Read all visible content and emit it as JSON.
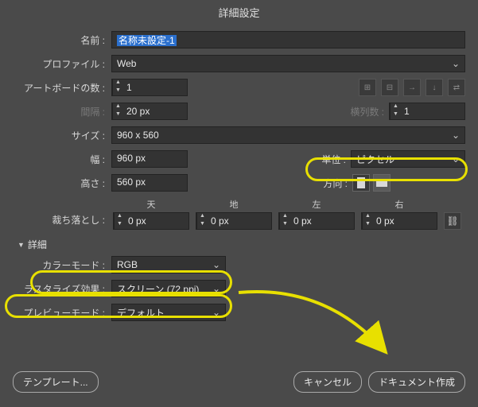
{
  "title": "詳細設定",
  "labels": {
    "name": "名前 :",
    "profile": "プロファイル :",
    "artboards": "アートボードの数 :",
    "spacing": "間隔 :",
    "columns": "横列数 :",
    "size": "サイズ :",
    "width": "幅 :",
    "height": "高さ :",
    "units": "単位 :",
    "orient": "方向 :",
    "bleed": "裁ち落とし :",
    "top": "天",
    "bottom": "地",
    "left": "左",
    "right": "右",
    "advanced": "詳細",
    "colormode": "カラーモード :",
    "raster": "ラスタライズ効果 :",
    "preview": "プレビューモード :"
  },
  "values": {
    "name": "名称未設定-1",
    "profile": "Web",
    "artboards": "1",
    "spacing": "20 px",
    "columns": "1",
    "size": "960 x 560",
    "width": "960 px",
    "height": "560 px",
    "units": "ピクセル",
    "bleed_top": "0 px",
    "bleed_bottom": "0 px",
    "bleed_left": "0 px",
    "bleed_right": "0 px",
    "colormode": "RGB",
    "raster": "スクリーン (72 ppi)",
    "preview": "デフォルト"
  },
  "buttons": {
    "templates": "テンプレート...",
    "cancel": "キャンセル",
    "create": "ドキュメント作成"
  }
}
